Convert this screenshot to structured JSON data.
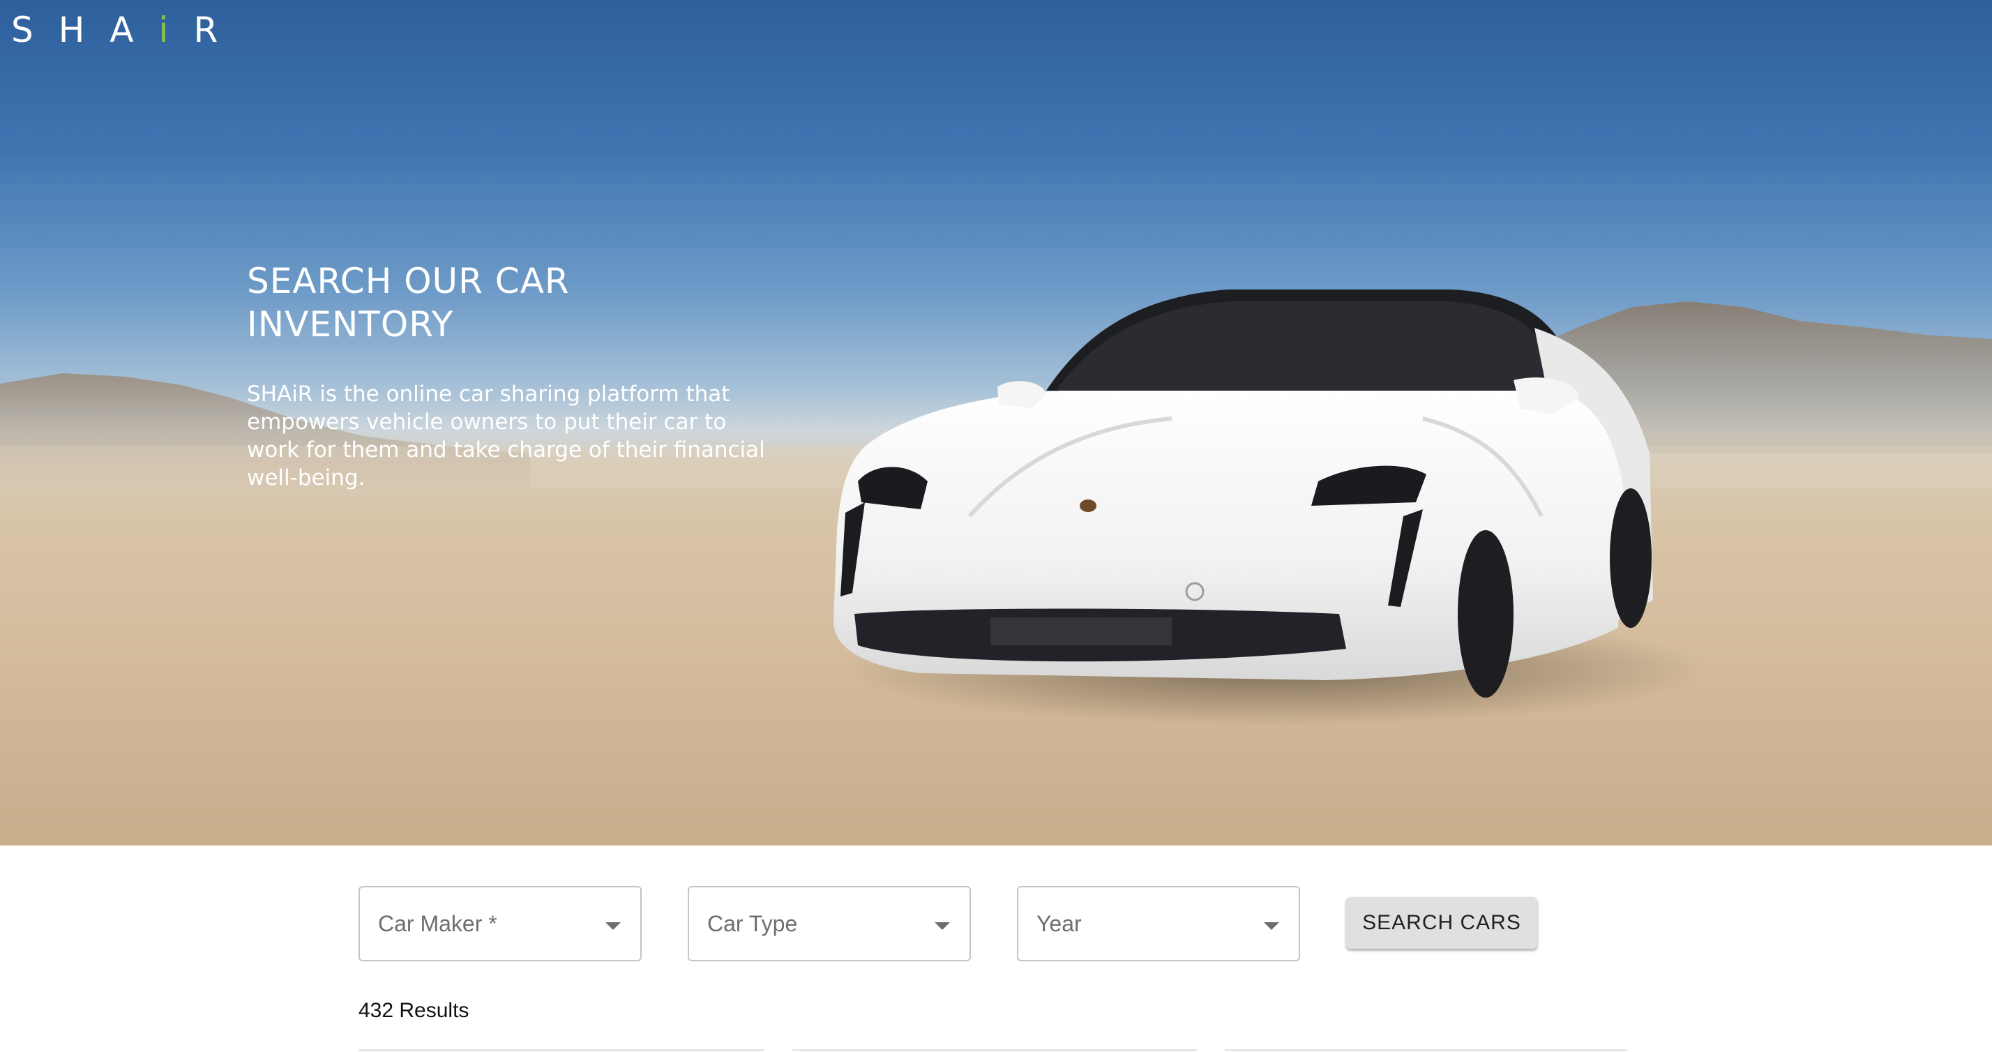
{
  "brand": {
    "logo_before": "SHA",
    "logo_accent": "i",
    "logo_after": "R",
    "accent_color": "#8cc43f"
  },
  "hero": {
    "title": "SEARCH OUR CAR INVENTORY",
    "description": "SHAiR is the online car sharing platform that empowers vehicle owners to put their car to work for them and take charge of their financial well-being."
  },
  "search": {
    "car_maker_label": "Car Maker *",
    "car_type_label": "Car Type",
    "year_label": "Year",
    "button_label": "SEARCH CARS"
  },
  "results": {
    "text": "432 Results"
  }
}
